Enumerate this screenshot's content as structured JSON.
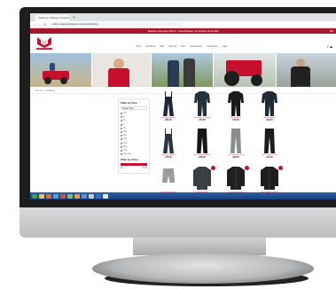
{
  "browser": {
    "tab_title": "Clothing | Massey Ferguson",
    "new_tab": "+",
    "url": "shop.masseyferguson.com/en/clothing"
  },
  "promo": {
    "text": "Massey Ferguson Shop · Free Delivery on Orders Over £50",
    "right": "EN"
  },
  "brand": {
    "accent": "#c8102e",
    "logo_text": "MASSEY FERGUSON"
  },
  "nav": {
    "items": [
      "New",
      "Gift Ideas",
      "Kids",
      "Women",
      "Men",
      "Accessories",
      "Collections",
      "Sale"
    ]
  },
  "header_icons": "⌕ ☰",
  "breadcrumb": "Home / Clothing",
  "filters": {
    "title": "Filter by Size",
    "select_value": "Select Size",
    "options": [
      "XS",
      "S",
      "M",
      "L",
      "XL",
      "XXL",
      "3XL",
      "4XL",
      "5XL",
      "6XL",
      "7XL",
      "One size"
    ],
    "price_title": "Filter by Price",
    "price_min": "£0",
    "price_max": "£100",
    "price_ticks": [
      "£",
      "£",
      "£",
      "£"
    ]
  },
  "sort": "Most Popular",
  "products": [
    {
      "name": "MF Bib Overalls",
      "price": "£85.00",
      "kind": "overall",
      "color": "#1c2733",
      "badge": false
    },
    {
      "name": "MF Work Trousers",
      "price": "£55.00",
      "kind": "jumpsuit",
      "color": "#22303d",
      "badge": false
    },
    {
      "name": "MF Coverall",
      "price": "£79.00",
      "kind": "jumpsuit",
      "color": "#1a1a1a",
      "badge": false
    },
    {
      "name": "MF Boilersuit",
      "price": "£69.00",
      "kind": "jumpsuit",
      "color": "#1f2a36",
      "badge": false
    },
    {
      "name": "MF Bib & Brace",
      "price": "£75.00",
      "kind": "overall",
      "color": "#2a3540",
      "badge": false
    },
    {
      "name": "MF Trousers Black",
      "price": "£39.00",
      "kind": "trousers",
      "color": "#151515",
      "badge": false
    },
    {
      "name": "MF Trousers Grey",
      "price": "£39.00",
      "kind": "trousers",
      "color": "#8a8d92",
      "badge": false
    },
    {
      "name": "MF Trousers Dark",
      "price": "£45.00",
      "kind": "trousers",
      "color": "#1c1c1c",
      "badge": false
    },
    {
      "name": "MF Work Shorts",
      "price": "£29.00",
      "kind": "shorts",
      "color": "#9a9ca0",
      "badge": false
    },
    {
      "name": "MF Softshell",
      "price": "£65.00",
      "kind": "jacket",
      "color": "#3a3f45",
      "badge": true
    },
    {
      "name": "MF Winter Jacket",
      "price": "£89.00",
      "kind": "jacket",
      "color": "#202020",
      "badge": true
    },
    {
      "name": "MF Padded Jacket",
      "price": "£95.00",
      "kind": "jacket",
      "color": "#1e1e1e",
      "badge": true
    }
  ]
}
